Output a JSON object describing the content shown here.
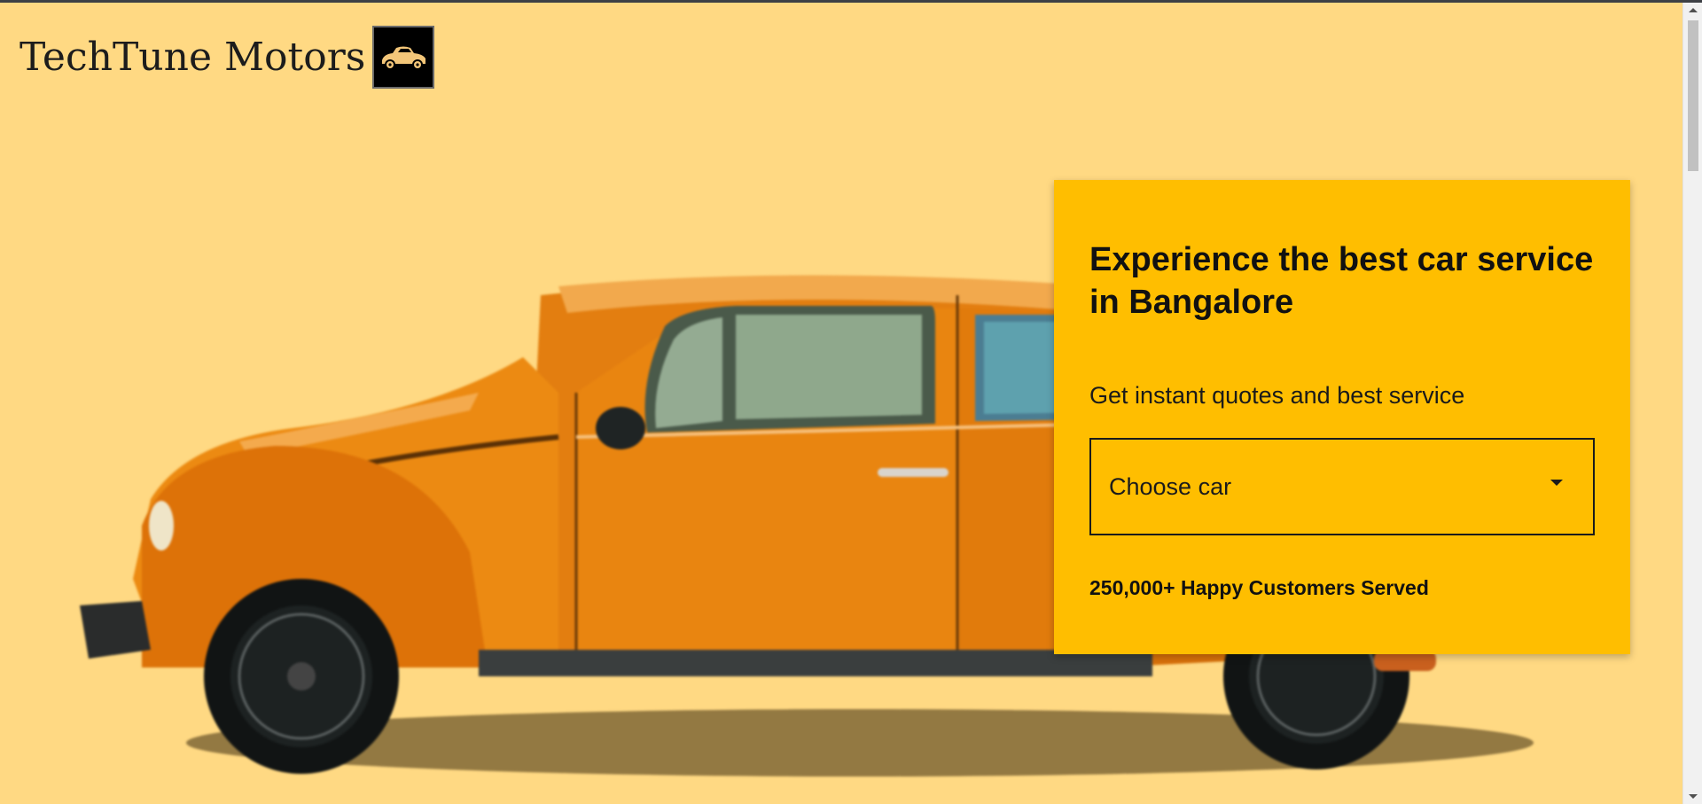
{
  "brand": {
    "name": "TechTune Motors",
    "logo_icon": "car-icon",
    "colors": {
      "page_background": "#ffd983",
      "card_background": "#ffbe00",
      "logo_badge": "#000000",
      "car_body": "#ec8a12"
    }
  },
  "hero": {
    "image_icon": "vintage-car-image"
  },
  "card": {
    "title": "Experience the best car service in Bangalore",
    "subtitle": "Get instant quotes and best service",
    "select": {
      "label": "Choose car",
      "icon": "caret-down-icon"
    },
    "stat": "250,000+ Happy Customers Served"
  }
}
